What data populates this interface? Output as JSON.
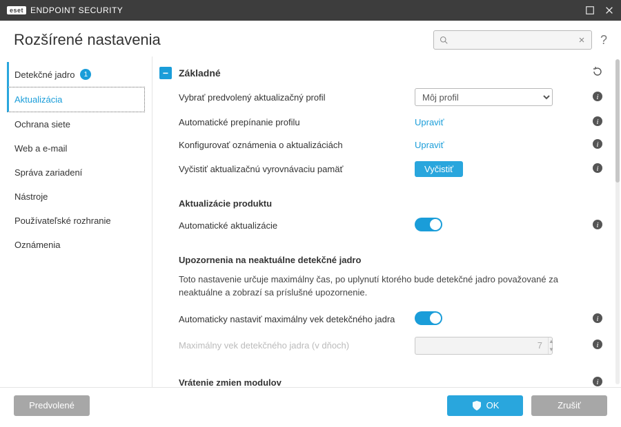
{
  "titlebar": {
    "brand_prefix": "eset",
    "brand": "ENDPOINT SECURITY"
  },
  "header": {
    "title": "Rozšírené nastavenia",
    "search_placeholder": ""
  },
  "sidebar": {
    "items": [
      {
        "label": "Detekčné jadro",
        "badge": "1"
      },
      {
        "label": "Aktualizácia"
      },
      {
        "label": "Ochrana siete"
      },
      {
        "label": "Web a e-mail"
      },
      {
        "label": "Správa zariadení"
      },
      {
        "label": "Nástroje"
      },
      {
        "label": "Používateľské rozhranie"
      },
      {
        "label": "Oznámenia"
      }
    ]
  },
  "main": {
    "section_basic": "Základné",
    "row_profile_label": "Vybrať predvolený aktualizačný profil",
    "row_profile_value": "Môj profil",
    "row_autoswitch_label": "Automatické prepínanie profilu",
    "row_autoswitch_link": "Upraviť",
    "row_confignotif_label": "Konfigurovať oznámenia o aktualizáciách",
    "row_confignotif_link": "Upraviť",
    "row_clearcache_label": "Vyčistiť aktualizačnú vyrovnávaciu pamäť",
    "row_clearcache_button": "Vyčistiť",
    "subhead_product": "Aktualizácie produktu",
    "row_autoupdate_label": "Automatické aktualizácie",
    "subhead_outdated": "Upozornenia na neaktuálne detekčné jadro",
    "desc_outdated": "Toto nastavenie určuje maximálny čas, po uplynutí ktorého bude detekčné jadro považované za neaktuálne a zobrazí sa príslušné upozornenie.",
    "row_autoage_label": "Automaticky nastaviť maximálny vek detekčného jadra",
    "row_maxage_label": "Maximálny vek detekčného jadra (v dňoch)",
    "row_maxage_value": "7",
    "subhead_rollback": "Vrátenie zmien modulov"
  },
  "footer": {
    "default": "Predvolené",
    "ok": "OK",
    "cancel": "Zrušiť"
  }
}
